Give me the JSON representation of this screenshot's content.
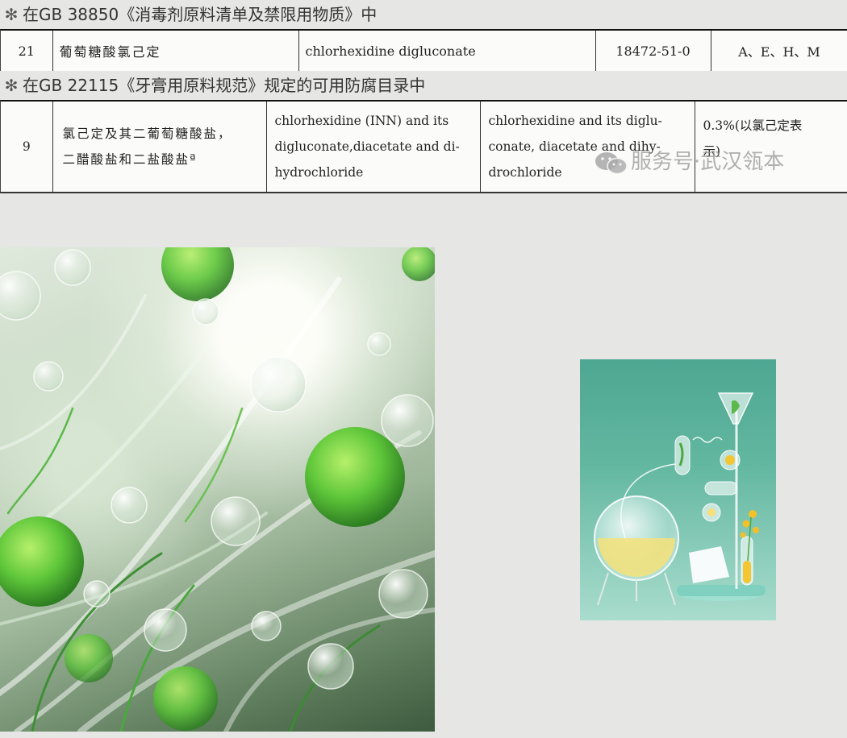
{
  "caption1": {
    "marker": "✻",
    "text": "在GB 38850《消毒剂原料清单及禁限用物质》中"
  },
  "table1": {
    "row": {
      "no": "21",
      "name_zh": "葡萄糖酸氯己定",
      "name_en": "chlorhexidine digluconate",
      "cas": "18472-51-0",
      "scope": "A、E、H、M"
    }
  },
  "caption2": {
    "marker": "✻",
    "text": "在GB 22115《牙膏用原料规范》规定的可用防腐目录中"
  },
  "table2": {
    "row": {
      "no": "9",
      "name_zh_line1": "氯己定及其二葡萄糖酸盐，",
      "name_zh_line2": "二醋酸盐和二盐酸盐ª",
      "inn_line1": "chlorhexidine (INN) and its",
      "inn_line2": "digluconate,diacetate and di-",
      "inn_line3": "hydrochloride",
      "inci_line1": "chlorhexidine and its diglu-",
      "inci_line2": "conate, diacetate and dihy-",
      "inci_line3": "drochloride",
      "limit_line1": "0.3%(以氯己定表",
      "limit_line2": "示)"
    }
  },
  "watermark": {
    "icon": "wechat-icon",
    "text": "服务号·武汉瓴本"
  },
  "colors": {
    "background": "#e6e6e4",
    "table_bg": "#fbfbfa",
    "text": "#222222"
  }
}
